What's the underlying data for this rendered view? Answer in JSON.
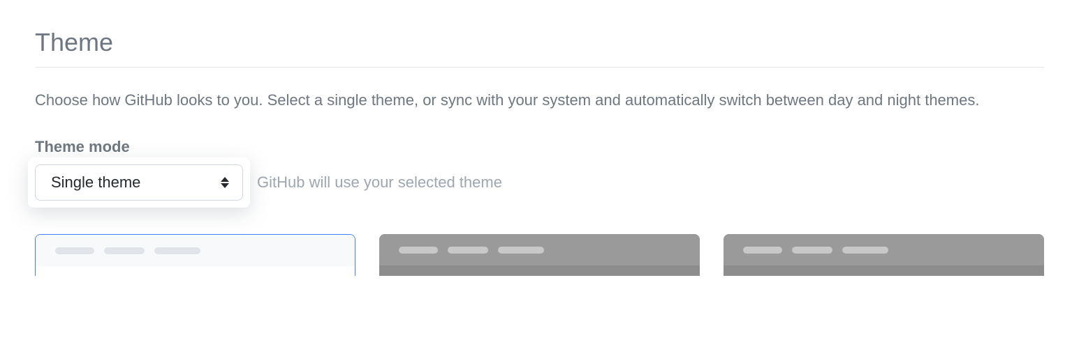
{
  "section": {
    "title": "Theme",
    "description": "Choose how GitHub looks to you. Select a single theme, or sync with your system and automatically switch between day and night themes."
  },
  "theme_mode": {
    "label": "Theme mode",
    "selected": "Single theme",
    "hint": "GitHub will use your selected theme"
  },
  "theme_previews": [
    {
      "variant": "light"
    },
    {
      "variant": "dark"
    },
    {
      "variant": "dark"
    }
  ]
}
